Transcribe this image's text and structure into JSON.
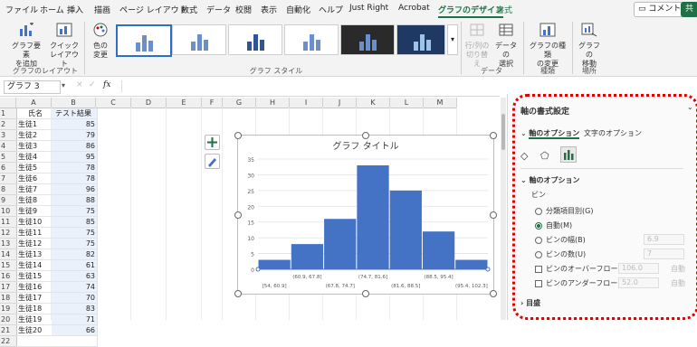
{
  "tabs": [
    "ファイル",
    "ホーム",
    "挿入",
    "描画",
    "ページ レイアウト",
    "数式",
    "データ",
    "校閲",
    "表示",
    "自動化",
    "ヘルプ",
    "Just Right",
    "Acrobat",
    "グラフのデザイン",
    "書式"
  ],
  "active_tab": "グラフのデザイン",
  "comment_button": "コメント",
  "share_button": "共",
  "ribbon": {
    "add_element": [
      "グラフ要素",
      "を追加"
    ],
    "quick_layout": [
      "クイック",
      "レイアウト"
    ],
    "layout_group": "グラフのレイアウト",
    "change_color": [
      "色の",
      "変更"
    ],
    "style_group": "グラフ スタイル",
    "switch_rowcol": [
      "行/列の",
      "切り替え"
    ],
    "select_data": [
      "データの",
      "選択"
    ],
    "data_group": "データ",
    "change_type": [
      "グラフの種類",
      "の変更"
    ],
    "type_group": "種類",
    "move_chart": [
      "グラフの",
      "移動"
    ],
    "place_group": "場所"
  },
  "namebox": "グラフ 3",
  "formula_icons": [
    "×",
    "✓",
    "fx"
  ],
  "columns": [
    "A",
    "B",
    "C",
    "D",
    "E",
    "F",
    "G",
    "H",
    "I",
    "J",
    "K",
    "L",
    "M"
  ],
  "headers": {
    "a": "氏名",
    "b": "テスト結果"
  },
  "rows": [
    {
      "n": "2",
      "name": "生徒1",
      "score": "85"
    },
    {
      "n": "3",
      "name": "生徒2",
      "score": "79"
    },
    {
      "n": "4",
      "name": "生徒3",
      "score": "86"
    },
    {
      "n": "5",
      "name": "生徒4",
      "score": "95"
    },
    {
      "n": "6",
      "name": "生徒5",
      "score": "78"
    },
    {
      "n": "7",
      "name": "生徒6",
      "score": "78"
    },
    {
      "n": "8",
      "name": "生徒7",
      "score": "96"
    },
    {
      "n": "9",
      "name": "生徒8",
      "score": "88"
    },
    {
      "n": "10",
      "name": "生徒9",
      "score": "75"
    },
    {
      "n": "11",
      "name": "生徒10",
      "score": "85"
    },
    {
      "n": "12",
      "name": "生徒11",
      "score": "75"
    },
    {
      "n": "13",
      "name": "生徒12",
      "score": "75"
    },
    {
      "n": "14",
      "name": "生徒13",
      "score": "82"
    },
    {
      "n": "15",
      "name": "生徒14",
      "score": "61"
    },
    {
      "n": "16",
      "name": "生徒15",
      "score": "63"
    },
    {
      "n": "17",
      "name": "生徒16",
      "score": "74"
    },
    {
      "n": "18",
      "name": "生徒17",
      "score": "70"
    },
    {
      "n": "19",
      "name": "生徒18",
      "score": "83"
    },
    {
      "n": "20",
      "name": "生徒19",
      "score": "71"
    },
    {
      "n": "21",
      "name": "生徒20",
      "score": "66"
    },
    {
      "n": "22",
      "name": "",
      "score": ""
    }
  ],
  "chart_data": {
    "type": "bar",
    "title": "グラフ タイトル",
    "categories": [
      "[54, 60.9]",
      "(60.9, 67.8]",
      "(67.8, 74.7]",
      "(74.7, 81.6]",
      "(81.6, 88.5]",
      "(88.5, 95.4]",
      "(95.4, 102.3]"
    ],
    "values": [
      3,
      8,
      16,
      33,
      25,
      12,
      3
    ],
    "ylim": [
      0,
      35
    ],
    "yticks": [
      "0",
      "5",
      "10",
      "15",
      "20",
      "25",
      "30",
      "35"
    ],
    "grid": true,
    "color": "#4472c4"
  },
  "pane": {
    "title": "軸の書式設定",
    "tab_axis": "軸のオプション",
    "tab_text": "文字のオプション",
    "section": "軸のオプション",
    "bin_label": "ビン",
    "opt_category": "分類項目別(G)",
    "opt_auto": "自動(M)",
    "opt_width": "ビンの幅(B)",
    "opt_count": "ビンの数(U)",
    "opt_overflow": "ビンのオーバーフロー(V)",
    "opt_underflow": "ビンのアンダーフロー(U)",
    "width_value": "6.9",
    "count_value": "7",
    "overflow_value": "106.0",
    "underflow_value": "52.0",
    "auto_word": "自動",
    "ticks_section": "目盛"
  }
}
